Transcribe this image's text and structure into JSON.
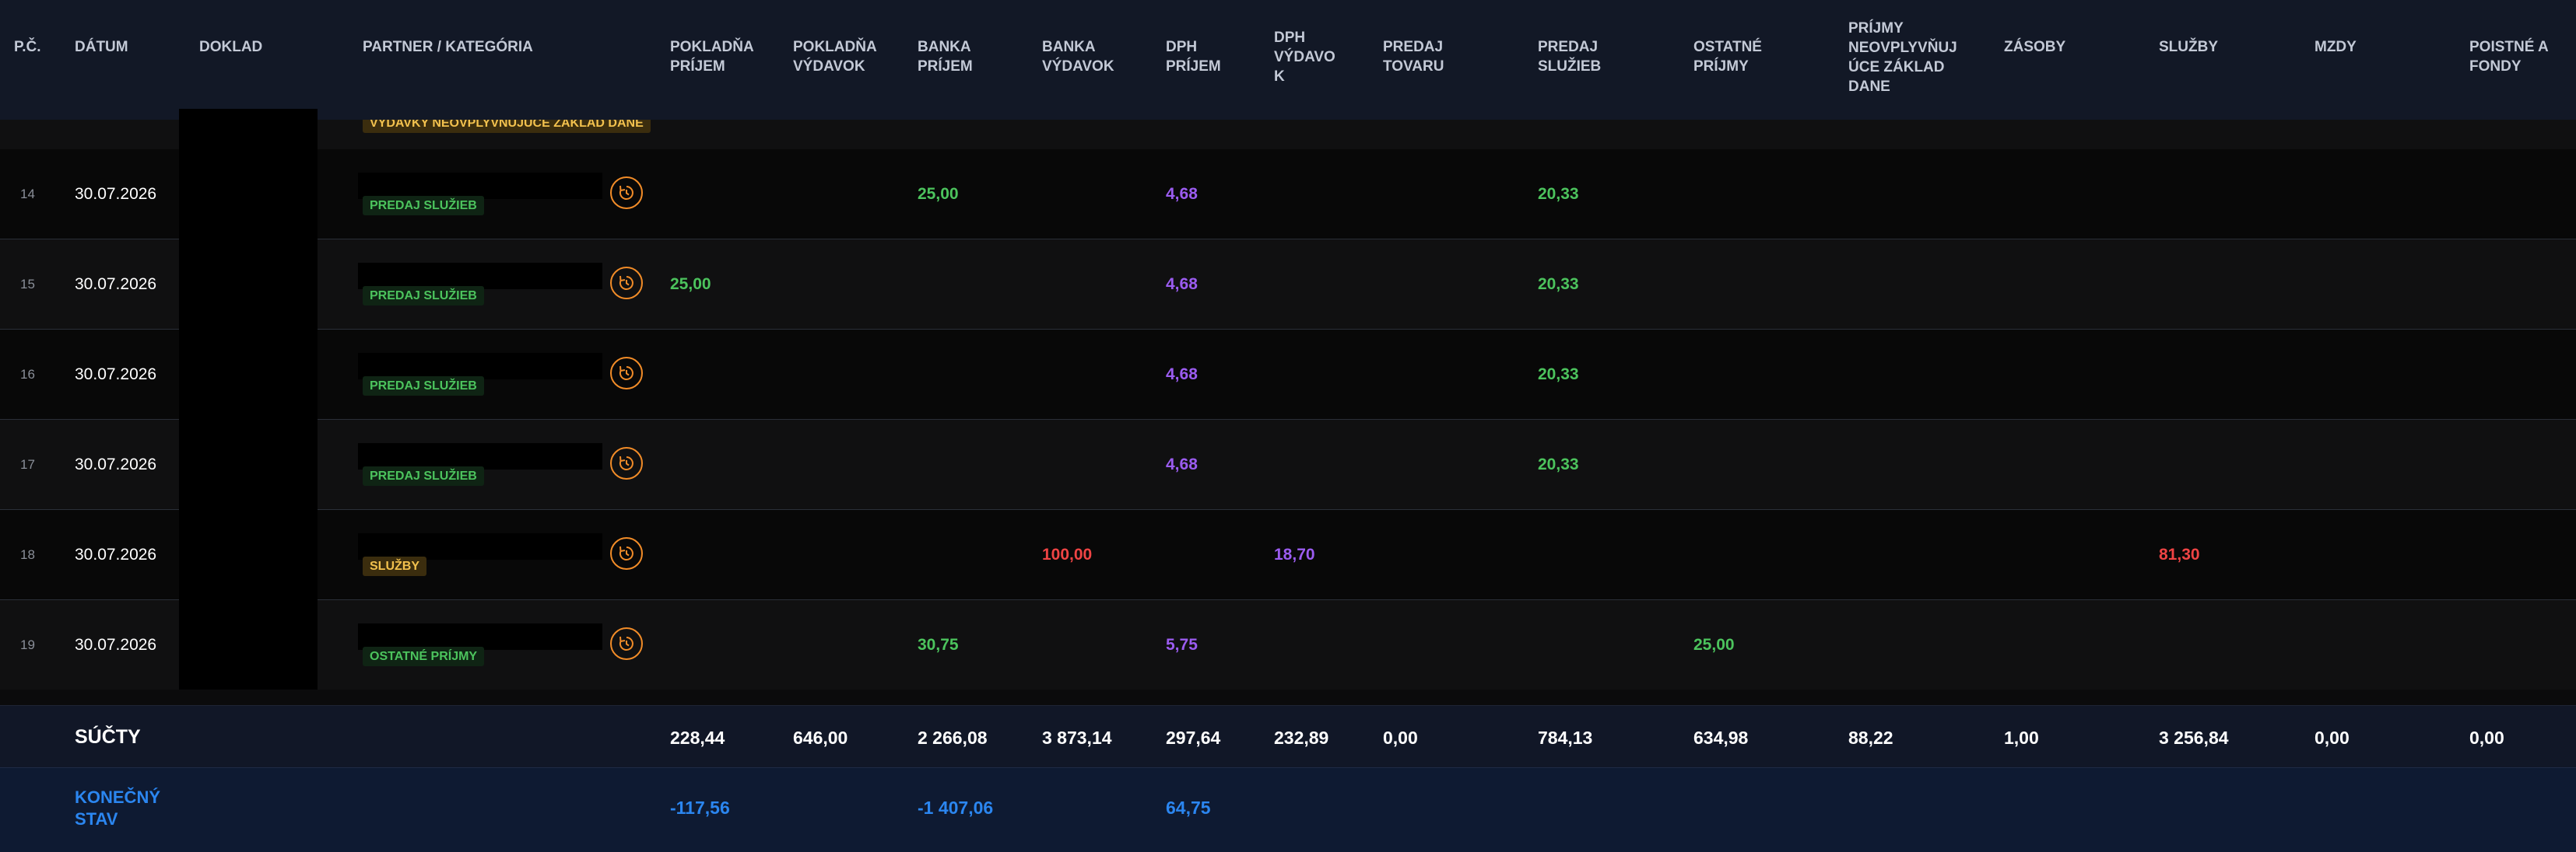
{
  "colors": {
    "header_bg": "#121826",
    "positive": "#4cc35d",
    "vat": "#9b5cf0",
    "expense": "#ef4444",
    "final": "#2b86f0",
    "icon_accent": "#f28c28"
  },
  "columns": {
    "pc": "P.Č.",
    "datum": "DÁTUM",
    "doklad": "DOKLAD",
    "partner": "PARTNER / KATEGÓRIA",
    "pokladna_prijem": "POKLADŇA\nPRÍJEM",
    "pokladna_vydavok": "POKLADŇA\nVÝDAVOK",
    "banka_prijem": "BANKA\nPRÍJEM",
    "banka_vydavok": "BANKA\nVÝDAVOK",
    "dph_prijem": "DPH\nPRÍJEM",
    "dph_vydavok": "DPH\nVÝDAVO\nK",
    "predaj_tovaru": "PREDAJ\nTOVARU",
    "predaj_sluzieb": "PREDAJ\nSLUŽIEB",
    "ostatne_prijmy": "OSTATNÉ\nPRÍJMY",
    "prijmy_neovplyvnujuce": "PRÍJMY\nNEOVPLYVŇUJ\nÚCE ZÁKLAD\nDANE",
    "zasoby": "ZÁSOBY",
    "sluzby": "SLUŽBY",
    "mzdy": "MZDY",
    "poistne": "POISTNÉ A\nFONDY"
  },
  "partial_row_badge": "VÝDAVKY NEOVPLYVŇUJÚCE ZÁKLAD DANE",
  "rows": [
    {
      "num": "14",
      "date": "30.07.2026",
      "category": "PREDAJ SLUŽIEB",
      "banka_prijem": "25,00",
      "dph_prijem": "4,68",
      "predaj_sluzieb": "20,33"
    },
    {
      "num": "15",
      "date": "30.07.2026",
      "category": "PREDAJ SLUŽIEB",
      "pokladna_prijem": "25,00",
      "dph_prijem": "4,68",
      "predaj_sluzieb": "20,33"
    },
    {
      "num": "16",
      "date": "30.07.2026",
      "category": "PREDAJ SLUŽIEB",
      "dph_prijem": "4,68",
      "predaj_sluzieb": "20,33"
    },
    {
      "num": "17",
      "date": "30.07.2026",
      "category": "PREDAJ SLUŽIEB",
      "dph_prijem": "4,68",
      "predaj_sluzieb": "20,33"
    },
    {
      "num": "18",
      "date": "30.07.2026",
      "category": "SLUŽBY",
      "banka_vydavok": "100,00",
      "dph_vydavok": "18,70",
      "sluzby": "81,30"
    },
    {
      "num": "19",
      "date": "30.07.2026",
      "category": "OSTATNÉ PRÍJMY",
      "banka_prijem": "30,75",
      "dph_prijem": "5,75",
      "ostatne_prijmy": "25,00"
    }
  ],
  "totals": {
    "label": "SÚČTY",
    "pokladna_prijem": "228,44",
    "pokladna_vydavok": "646,00",
    "banka_prijem": "2 266,08",
    "banka_vydavok": "3 873,14",
    "dph_prijem": "297,64",
    "dph_vydavok": "232,89",
    "predaj_tovaru": "0,00",
    "predaj_sluzieb": "784,13",
    "ostatne_prijmy": "634,98",
    "prijmy_neovplyvnujuce": "88,22",
    "zasoby": "1,00",
    "sluzby": "3 256,84",
    "mzdy": "0,00",
    "poistne": "0,00"
  },
  "final": {
    "label": "KONEČNÝ\nSTAV",
    "pokladna": "-117,56",
    "banka": "-1 407,06",
    "dph": "64,75"
  }
}
